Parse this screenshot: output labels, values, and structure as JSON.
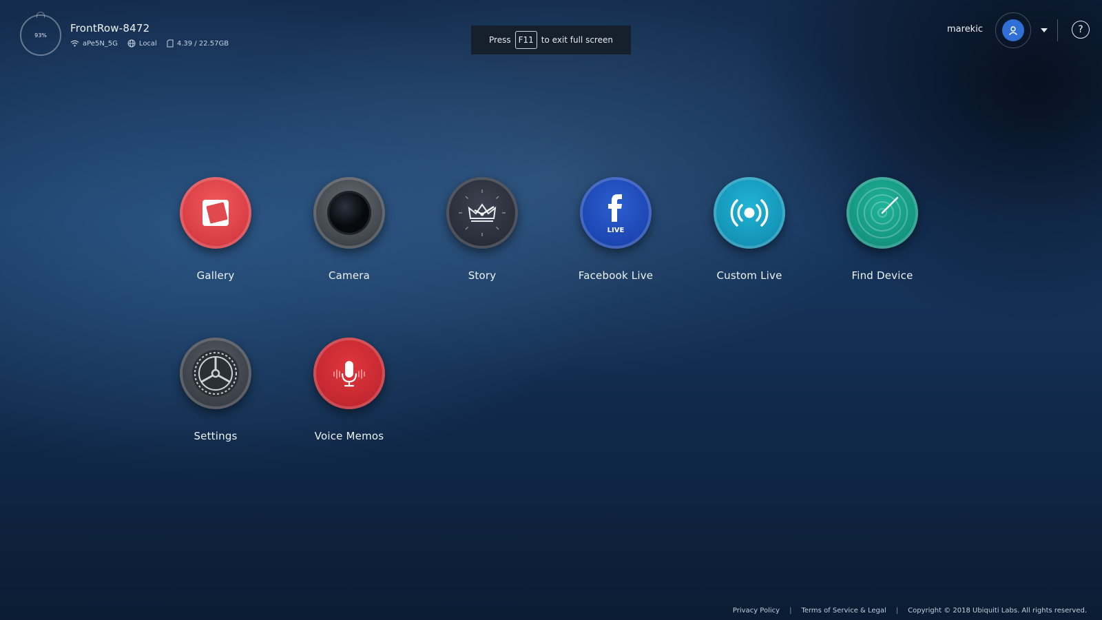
{
  "device": {
    "battery": "93%",
    "name": "FrontRow-8472",
    "wifi": "aPe5N_5G",
    "network": "Local",
    "storage": "4.39 / 22.57GB"
  },
  "fullscreen_hint": {
    "prefix": "Press",
    "key": "F11",
    "suffix": "to exit full screen"
  },
  "user": {
    "username": "marekic"
  },
  "help_label": "?",
  "apps": [
    {
      "label": "Gallery",
      "icon": "gallery-icon",
      "color": "#e04a4f"
    },
    {
      "label": "Camera",
      "icon": "camera-icon",
      "color": "#3e434a"
    },
    {
      "label": "Story",
      "icon": "story-icon",
      "color": "#272b35"
    },
    {
      "label": "Facebook Live",
      "icon": "facebook-live-icon",
      "color": "#1b45b1",
      "badge": "LIVE"
    },
    {
      "label": "Custom Live",
      "icon": "broadcast-icon",
      "color": "#1393b6"
    },
    {
      "label": "Find Device",
      "icon": "radar-icon",
      "color": "#139380"
    },
    {
      "label": "Settings",
      "icon": "gear-icon",
      "color": "#3a3e46"
    },
    {
      "label": "Voice Memos",
      "icon": "microphone-icon",
      "color": "#c22730"
    }
  ],
  "footer": {
    "privacy": "Privacy Policy",
    "terms": "Terms of Service & Legal",
    "copyright": "Copyright © 2018 Ubiquiti Labs. All rights reserved."
  }
}
